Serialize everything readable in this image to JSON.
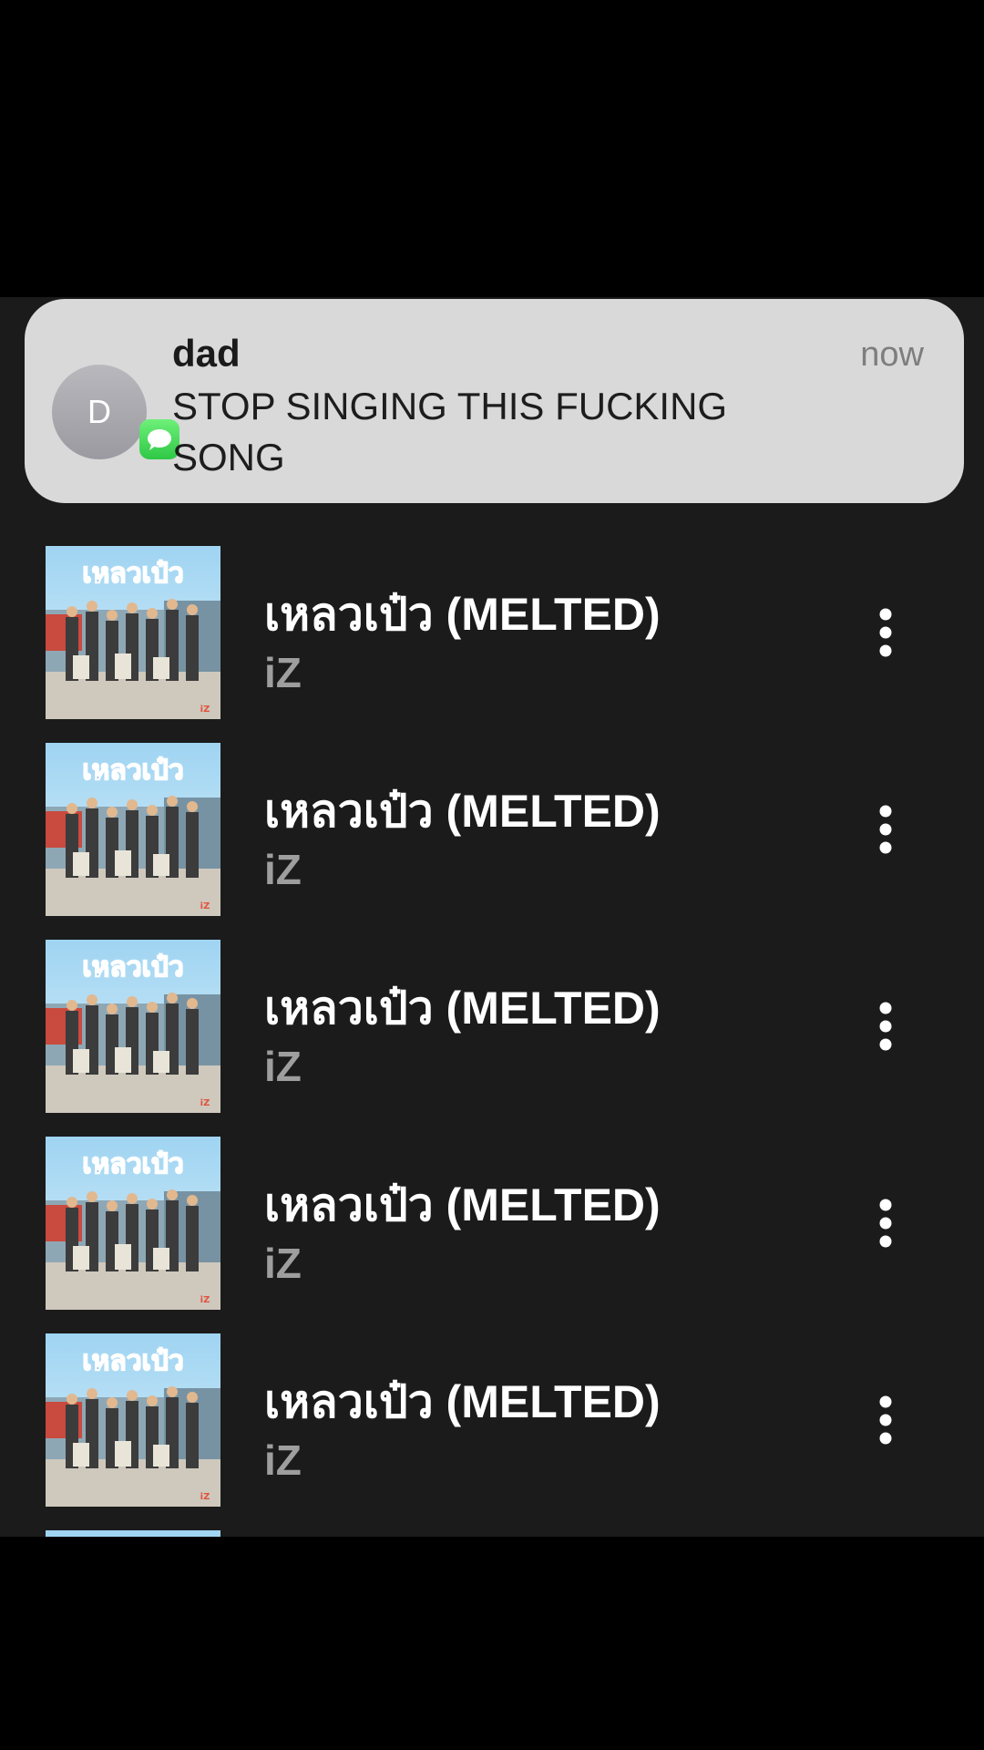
{
  "notification": {
    "sender": "dad",
    "time": "now",
    "message": "STOP SINGING THIS FUCKING SONG",
    "avatar_initial": "D",
    "app_icon": "messages-icon",
    "app_icon_color": "#34c759"
  },
  "songs": [
    {
      "title": "เหลวเป๋ว (MELTED)",
      "artist": "iZ",
      "art_text": "เหลวเป๋ว"
    },
    {
      "title": "เหลวเป๋ว (MELTED)",
      "artist": "iZ",
      "art_text": "เหลวเป๋ว"
    },
    {
      "title": "เหลวเป๋ว (MELTED)",
      "artist": "iZ",
      "art_text": "เหลวเป๋ว"
    },
    {
      "title": "เหลวเป๋ว (MELTED)",
      "artist": "iZ",
      "art_text": "เหลวเป๋ว"
    },
    {
      "title": "เหลวเป๋ว (MELTED)",
      "artist": "iZ",
      "art_text": "เหลวเป๋ว"
    }
  ],
  "more_icon": "more-vertical-icon",
  "colors": {
    "background": "#1b1b1b",
    "title": "#ffffff",
    "artist": "#9e9e9e",
    "notification_bg": "#d9d9d9"
  }
}
